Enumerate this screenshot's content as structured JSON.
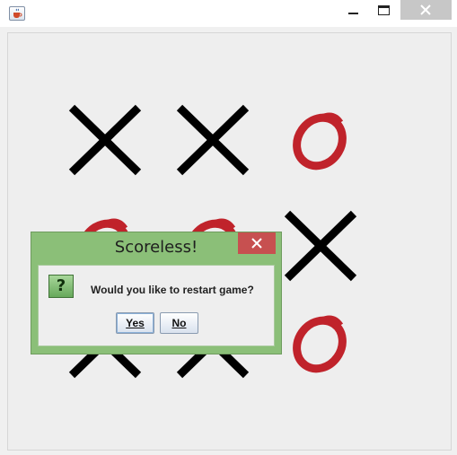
{
  "window": {
    "app_icon": "java-cup-icon",
    "controls": [
      "minimize-icon",
      "maximize-icon",
      "close-icon"
    ]
  },
  "board": {
    "cells": [
      [
        "X",
        "X",
        "O"
      ],
      [
        "O",
        "O",
        "X"
      ],
      [
        "X",
        "X",
        "O"
      ]
    ],
    "colors": {
      "x": "#000000",
      "o": "#c0232b"
    }
  },
  "dialog": {
    "title": "Scoreless!",
    "icon": "question-icon",
    "icon_glyph": "?",
    "message": "Would you like to restart game?",
    "yes_label": "Yes",
    "no_label": "No",
    "colors": {
      "frame": "#8bbf78",
      "close": "#c75050"
    }
  }
}
